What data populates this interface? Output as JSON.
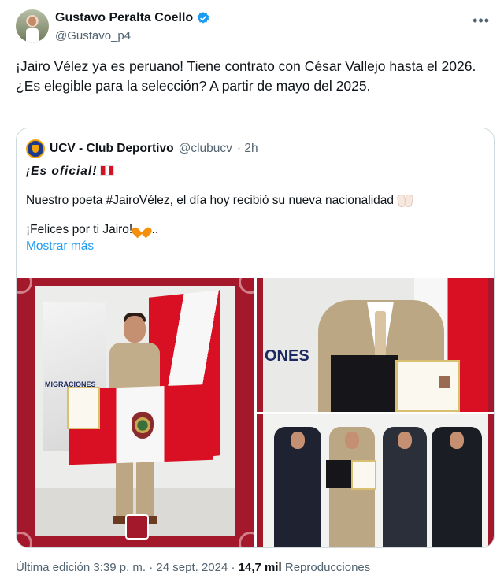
{
  "author": {
    "display_name": "Gustavo Peralta Coello",
    "handle": "@Gustavo_p4"
  },
  "tweet": {
    "line1": "¡Jairo Vélez ya es peruano! Tiene contrato con César Vallejo hasta el 2026.",
    "line2": "¿Es elegible para la selección? A partir de mayo del 2025."
  },
  "quote": {
    "display_name": "UCV - Club Deportivo",
    "handle": "@clubucv",
    "time": "· 2h",
    "headline": "¡Es oficial!",
    "body_line": "Nuestro poeta #JairoVélez, el día hoy recibió su nueva nacionalidad",
    "closing_line": "¡Felices por ti Jairo!",
    "ellipsis": "...",
    "show_more": "Mostrar más",
    "photo1_sign": "MIGRACIONES",
    "photo2_sign": "ONES"
  },
  "footer": {
    "edited": "Última edición 3:39 p. m. · 24 sept. 2024 · ",
    "views_count": "14,7 mil",
    "views_label": " Reproducciones"
  },
  "colors": {
    "accent_blue": "#1d9bf0",
    "text_primary": "#0f1419",
    "text_secondary": "#536471",
    "peru_red": "#d91023"
  }
}
